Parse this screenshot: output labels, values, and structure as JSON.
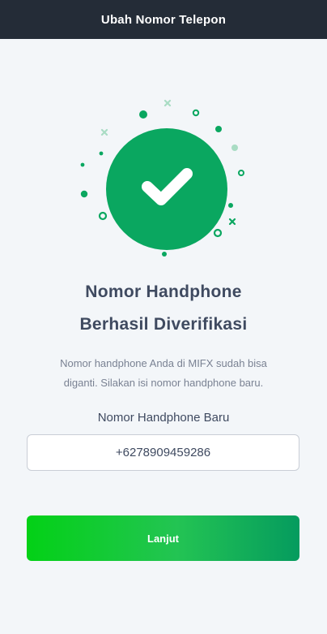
{
  "header": {
    "title": "Ubah Nomor Telepon"
  },
  "illustration": {
    "icon": "checkmark-icon",
    "circle_color": "#0aa760"
  },
  "success": {
    "title_line1": "Nomor Handphone",
    "title_line2": "Berhasil Diverifikasi",
    "desc_line1": "Nomor handphone Anda di MIFX sudah bisa",
    "desc_line2": "diganti. Silakan isi nomor handphone baru."
  },
  "form": {
    "phone_label": "Nomor Handphone Baru",
    "phone_value": "+6278909459286"
  },
  "actions": {
    "next_label": "Lanjut"
  },
  "colors": {
    "header_bg": "#242c37",
    "accent": "#0aa760",
    "page_bg": "#f3f6f9"
  }
}
